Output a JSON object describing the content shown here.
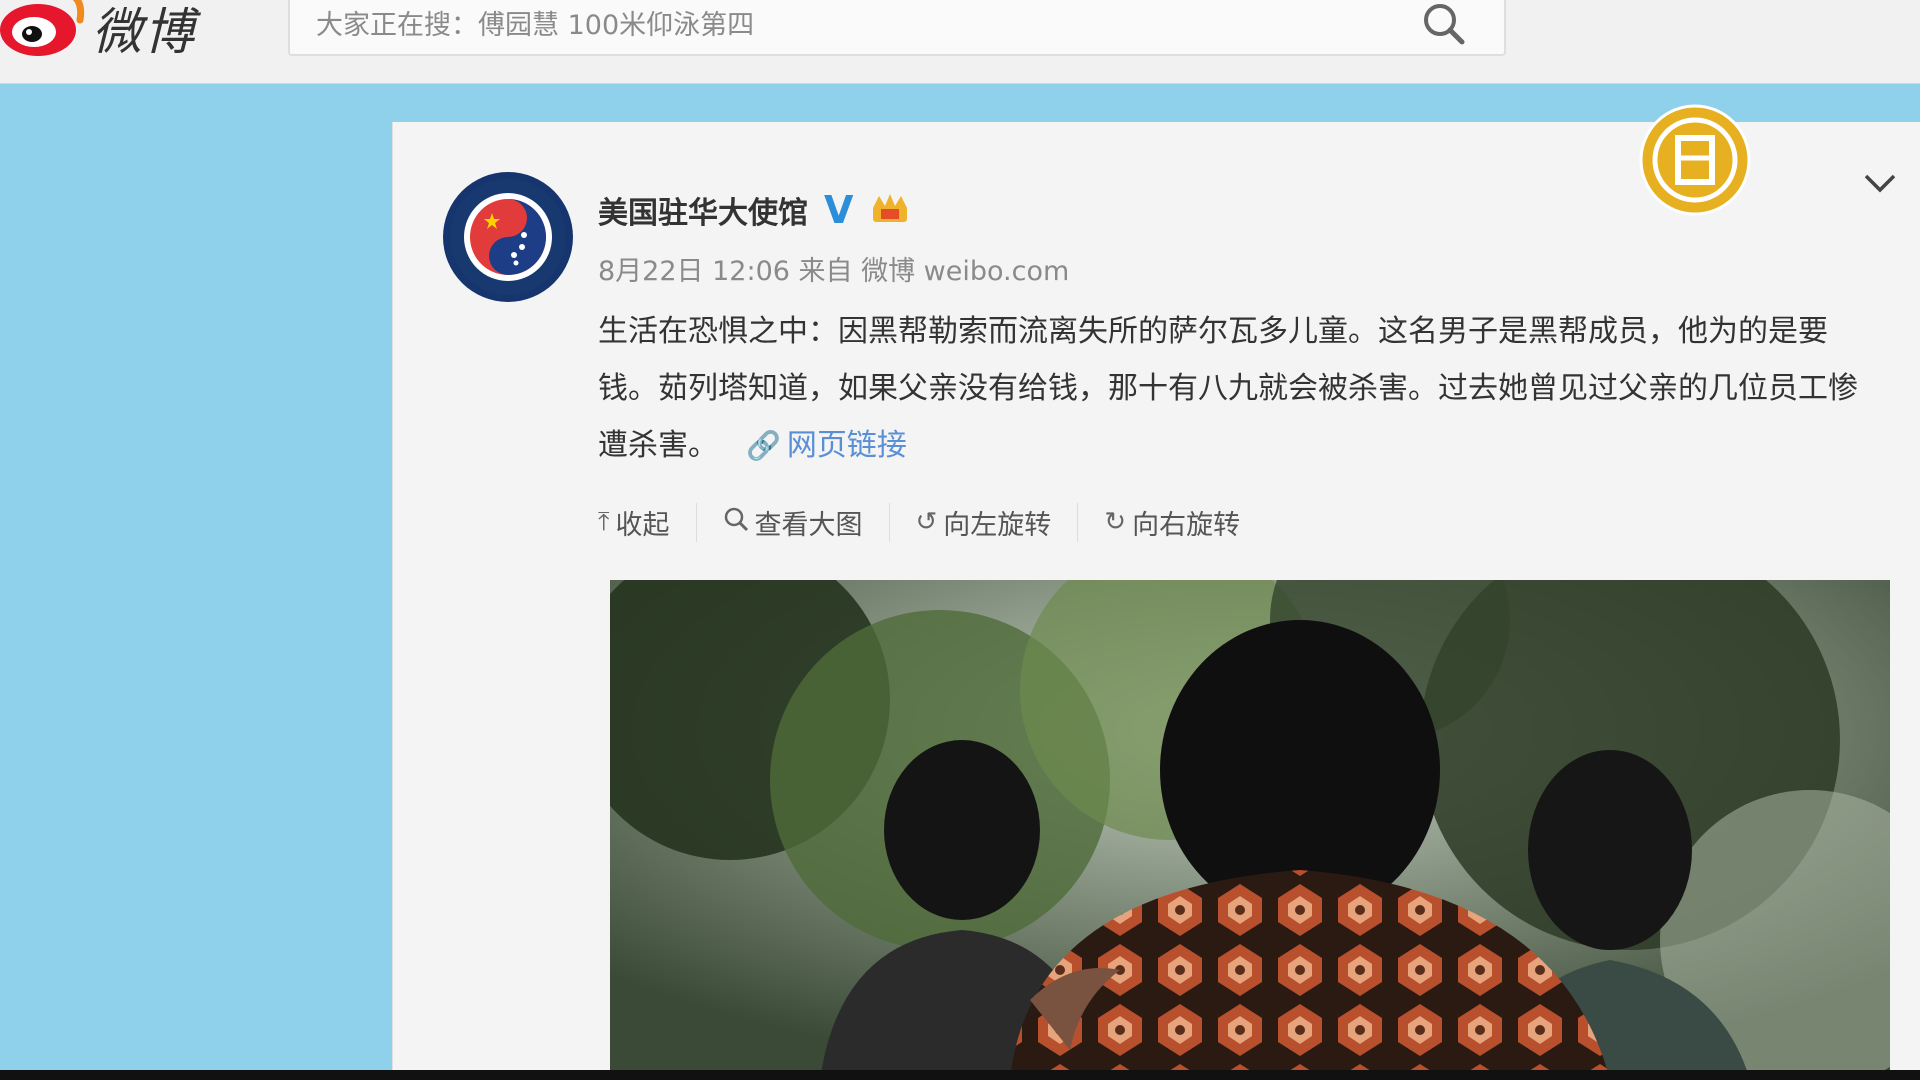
{
  "app": {
    "logo_text": "微博"
  },
  "search": {
    "placeholder": "大家正在搜：傅园慧 100米仰泳第四"
  },
  "post": {
    "author": "美国驻华大使馆",
    "meta": "8月22日 12:06 来自 微博 weibo.com",
    "text": "生活在恐惧之中：因黑帮勒索而流离失所的萨尔瓦多儿童。这名男子是黑帮成员，他为的是要钱。茹列塔知道，如果父亲没有给钱，那十有八九就会被杀害。过去她曾见过父亲的几位员工惨遭杀害。",
    "link_label": "网页链接",
    "actions": [
      {
        "label": "收起",
        "icon": "collapse-icon"
      },
      {
        "label": "查看大图",
        "icon": "search-icon"
      },
      {
        "label": "向左旋转",
        "icon": "rotate-left-icon"
      },
      {
        "label": "向右旋转",
        "icon": "rotate-right-icon"
      }
    ]
  },
  "colors": {
    "page_background": "#8fd0ea",
    "verified": "#2b8ed9",
    "link": "#5a8fd6",
    "weibo_red": "#e6162d"
  }
}
